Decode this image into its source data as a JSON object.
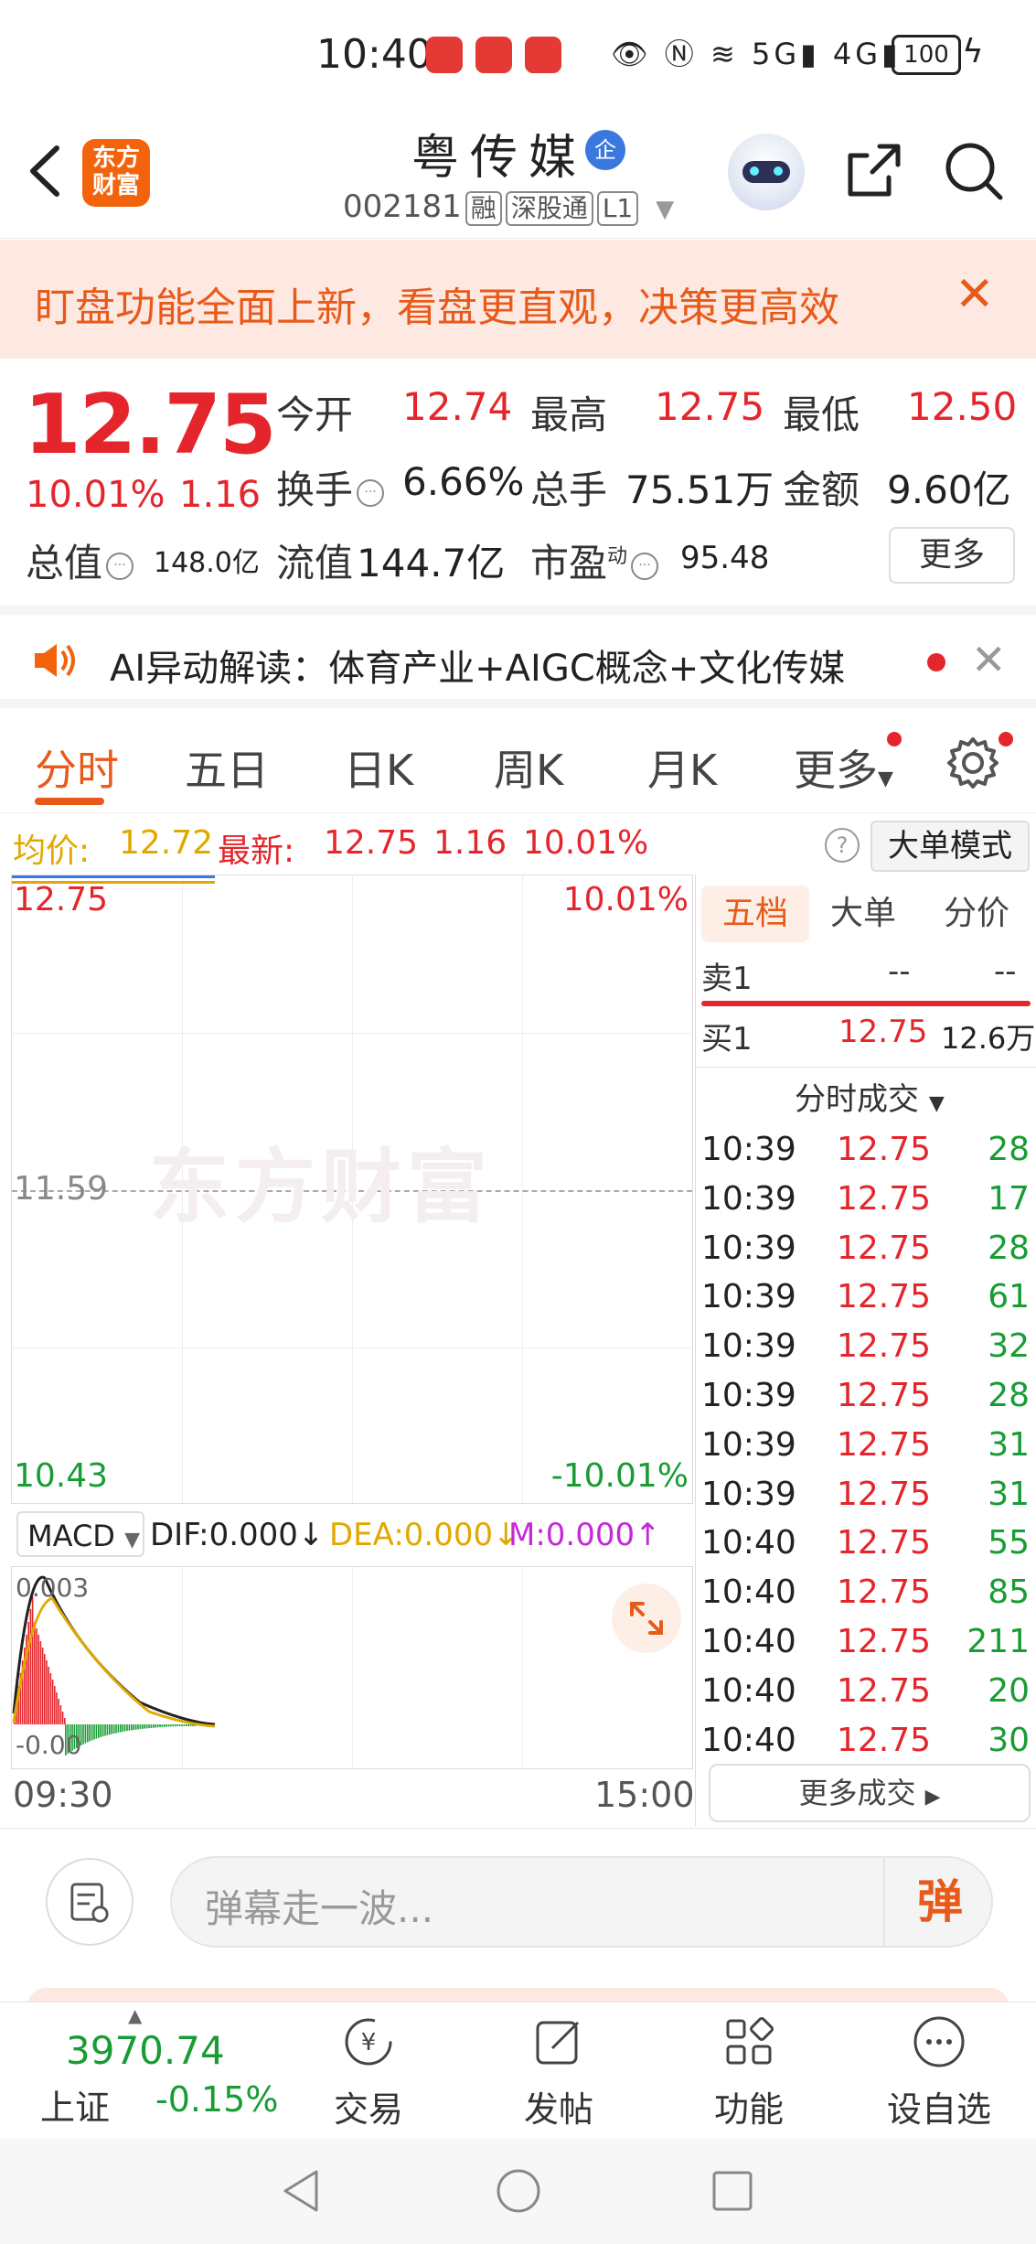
{
  "status_bar": {
    "time": "10:40",
    "battery": "100"
  },
  "header": {
    "logo_text_1": "东方",
    "logo_text_2": "财富",
    "stock_name": "粤传媒",
    "badge": "企",
    "code": "002181",
    "tags": [
      "融",
      "深股通",
      "L1"
    ]
  },
  "banner": {
    "text": "盯盘功能全面上新，看盘更直观，决策更高效"
  },
  "quote": {
    "price": "12.75",
    "pct": "10.01%",
    "change": "1.16",
    "open_label": "今开",
    "open": "12.74",
    "high_label": "最高",
    "high": "12.75",
    "low_label": "最低",
    "low": "12.50",
    "turnover_label": "换手",
    "turnover": "6.66%",
    "volume_label": "总手",
    "volume": "75.51万",
    "amount_label": "金额",
    "amount": "9.60亿",
    "mktcap_label": "总值",
    "mktcap": "148.0亿",
    "float_label": "流值",
    "float": "144.7亿",
    "pe_label": "市盈",
    "pe_super": "动",
    "pe": "95.48",
    "more": "更多"
  },
  "ai_bar": {
    "text": "AI异动解读：体育产业+AIGC概念+文化传媒"
  },
  "tabs": [
    "分时",
    "五日",
    "日K",
    "周K",
    "月K",
    "更多"
  ],
  "summary": {
    "avg_label": "均价:",
    "avg": "12.72",
    "latest_label": "最新:",
    "latest": "12.75",
    "change": "1.16",
    "pct": "10.01%",
    "mode_button": "大单模式"
  },
  "chart": {
    "top_price": "12.75",
    "top_pct": "10.01%",
    "mid_price": "11.59",
    "bottom_price": "10.43",
    "bottom_pct": "-10.01%",
    "watermark": "东方财富",
    "x_start": "09:30",
    "x_end": "15:00"
  },
  "macd": {
    "selector": "MACD",
    "dif": "DIF:0.000",
    "dea": "DEA:0.000",
    "m": "M:0.000",
    "top": "0.003",
    "bottom": "-0.00"
  },
  "panel": {
    "tabs": [
      "五档",
      "大单",
      "分价"
    ],
    "sell1_label": "卖1",
    "sell1_price": "--",
    "sell1_vol": "--",
    "buy1_label": "买1",
    "buy1_price": "12.75",
    "buy1_vol": "12.6万",
    "trades_title": "分时成交",
    "trades": [
      {
        "time": "10:39",
        "price": "12.75",
        "vol": "28"
      },
      {
        "time": "10:39",
        "price": "12.75",
        "vol": "17"
      },
      {
        "time": "10:39",
        "price": "12.75",
        "vol": "28"
      },
      {
        "time": "10:39",
        "price": "12.75",
        "vol": "61"
      },
      {
        "time": "10:39",
        "price": "12.75",
        "vol": "32"
      },
      {
        "time": "10:39",
        "price": "12.75",
        "vol": "28"
      },
      {
        "time": "10:39",
        "price": "12.75",
        "vol": "31"
      },
      {
        "time": "10:39",
        "price": "12.75",
        "vol": "31"
      },
      {
        "time": "10:40",
        "price": "12.75",
        "vol": "55"
      },
      {
        "time": "10:40",
        "price": "12.75",
        "vol": "85"
      },
      {
        "time": "10:40",
        "price": "12.75",
        "vol": "211"
      },
      {
        "time": "10:40",
        "price": "12.75",
        "vol": "20"
      },
      {
        "time": "10:40",
        "price": "12.75",
        "vol": "30"
      }
    ],
    "more_trades": "更多成交"
  },
  "comment": {
    "placeholder": "弹幕走一波...",
    "danmu": "弹"
  },
  "bottom_nav": {
    "index_value": "3970.74",
    "index_name": "上证",
    "index_pct": "-0.15%",
    "items": [
      "交易",
      "发帖",
      "功能",
      "设自选"
    ]
  },
  "colors": {
    "up": "#e4262c",
    "down": "#189c34",
    "accent": "#e85a1a",
    "avg_line": "#e0a800"
  }
}
